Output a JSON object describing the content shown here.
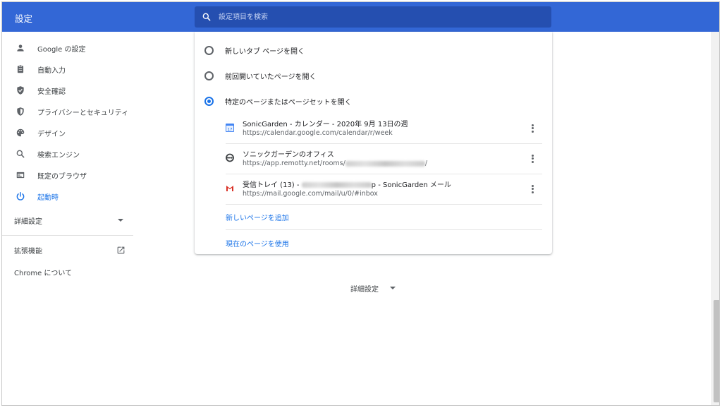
{
  "header": {
    "title": "設定",
    "search_placeholder": "設定項目を検索"
  },
  "sidebar": {
    "items": [
      {
        "label": "Google の設定",
        "icon": "person-icon"
      },
      {
        "label": "自動入力",
        "icon": "clipboard-icon"
      },
      {
        "label": "安全確認",
        "icon": "shield-check-icon"
      },
      {
        "label": "プライバシーとセキュリティ",
        "icon": "shield-icon"
      },
      {
        "label": "デザイン",
        "icon": "palette-icon"
      },
      {
        "label": "検索エンジン",
        "icon": "search-icon"
      },
      {
        "label": "既定のブラウザ",
        "icon": "browser-icon"
      },
      {
        "label": "起動時",
        "icon": "power-icon",
        "active": true
      }
    ],
    "advanced_label": "詳細設定",
    "extensions_label": "拡張機能",
    "about_label": "Chrome について"
  },
  "startup": {
    "options": [
      {
        "label": "新しいタブ ページを開く",
        "selected": false
      },
      {
        "label": "前回開いていたページを開く",
        "selected": false
      },
      {
        "label": "特定のページまたはページセットを開く",
        "selected": true
      }
    ],
    "pages": [
      {
        "title": "SonicGarden - カレンダー - 2020年 9月 13日の週",
        "url": "https://calendar.google.com/calendar/r/week",
        "icon": "calendar-icon"
      },
      {
        "title": "ソニックガーデンのオフィス",
        "url_prefix": "https://app.remotty.net/rooms/",
        "url_suffix": "/",
        "icon": "remotty-icon"
      },
      {
        "title_prefix": "受信トレイ (13) - ",
        "title_suffix": "p - SonicGarden メール",
        "url": "https://mail.google.com/mail/u/0/#inbox",
        "icon": "gmail-icon"
      }
    ],
    "add_page_label": "新しいページを追加",
    "use_current_label": "現在のページを使用"
  },
  "advanced_button_label": "詳細設定",
  "colors": {
    "header": "#3367d6",
    "search_bg": "#254fb0",
    "accent": "#1a73e8"
  }
}
